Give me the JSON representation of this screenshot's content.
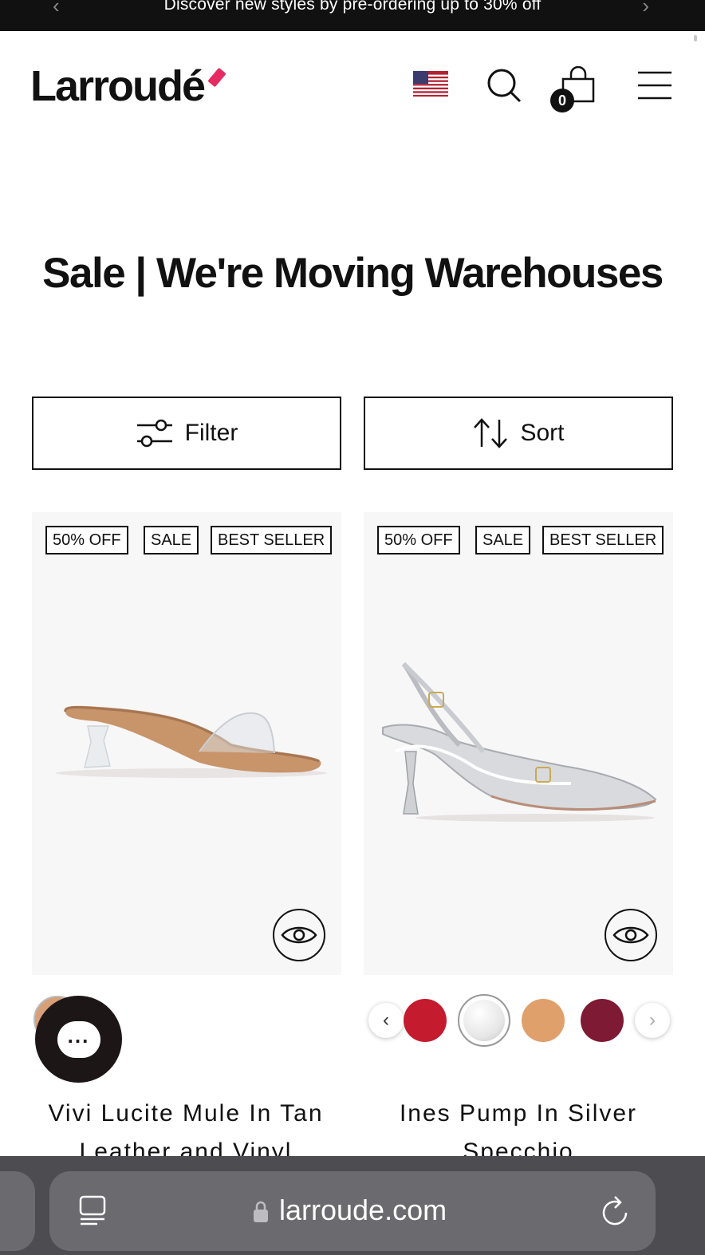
{
  "announcement": {
    "message": "Discover new styles by pre-ordering up to 30% off",
    "prev_arrow": "‹",
    "next_arrow": "›"
  },
  "header": {
    "logo": "Larroudé",
    "cart_count": "0",
    "icons": [
      "us-flag-icon",
      "search-icon",
      "cart-icon",
      "menu-icon"
    ]
  },
  "page": {
    "title": "Sale | We're Moving Warehouses"
  },
  "controls": {
    "filter_label": "Filter",
    "sort_label": "Sort"
  },
  "products": [
    {
      "name": "Vivi Lucite Mule In Tan Leather and Vinyl",
      "badges": [
        "50% OFF",
        "SALE",
        "BEST SELLER"
      ],
      "swatches": [
        "#d7a078"
      ]
    },
    {
      "name": "Ines Pump In Silver Specchio",
      "badges": [
        "50% OFF",
        "SALE",
        "BEST SELLER"
      ],
      "swatches": [
        "#c41b2e",
        "#d9d9d9",
        "#dfa06c",
        "#7e1a33"
      ]
    }
  ],
  "chat": {
    "label": "..."
  },
  "browser": {
    "url": "larroude.com"
  },
  "colors": {
    "brand_accent": "#e52b62",
    "ink": "#111111",
    "card_bg": "#f8f7f8"
  }
}
